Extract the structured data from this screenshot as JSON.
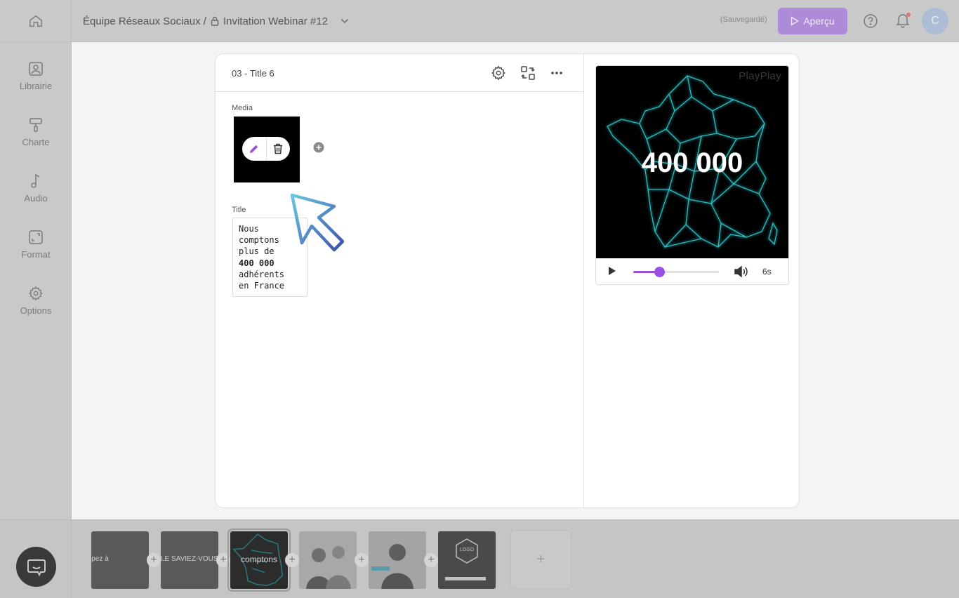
{
  "header": {
    "breadcrumb_team": "Équipe Réseaux Sociaux /",
    "breadcrumb_project": "Invitation Webinar #12",
    "save_status": "(Sauvegardé)",
    "preview_label": "Aperçu",
    "avatar_initial": "C",
    "accent": "#ad8bd8"
  },
  "sidebar": {
    "items": [
      {
        "label": "Librairie",
        "icon": "image-icon"
      },
      {
        "label": "Charte",
        "icon": "paint-roller-icon"
      },
      {
        "label": "Audio",
        "icon": "music-note-icon"
      },
      {
        "label": "Format",
        "icon": "resize-icon"
      },
      {
        "label": "Options",
        "icon": "gear-icon"
      }
    ]
  },
  "editor": {
    "scene_title": "03 - Title 6",
    "media_label": "Media",
    "title_label": "Title",
    "title_lines": [
      "Nous",
      "comptons",
      "plus de",
      "400 000",
      "adhérents",
      "en France"
    ]
  },
  "preview": {
    "watermark": "PlayPlay",
    "headline": "400 000",
    "duration": "6s",
    "progress": 0.3,
    "accent": "#9b51e0"
  },
  "timeline": {
    "slides": [
      {
        "text": "ipez à"
      },
      {
        "text": "LE SAVIEZ-VOUS ?"
      },
      {
        "text": "comptons"
      },
      {
        "text": ""
      },
      {
        "text": ""
      },
      {
        "text": "LOGO"
      }
    ],
    "add_label": "+"
  }
}
